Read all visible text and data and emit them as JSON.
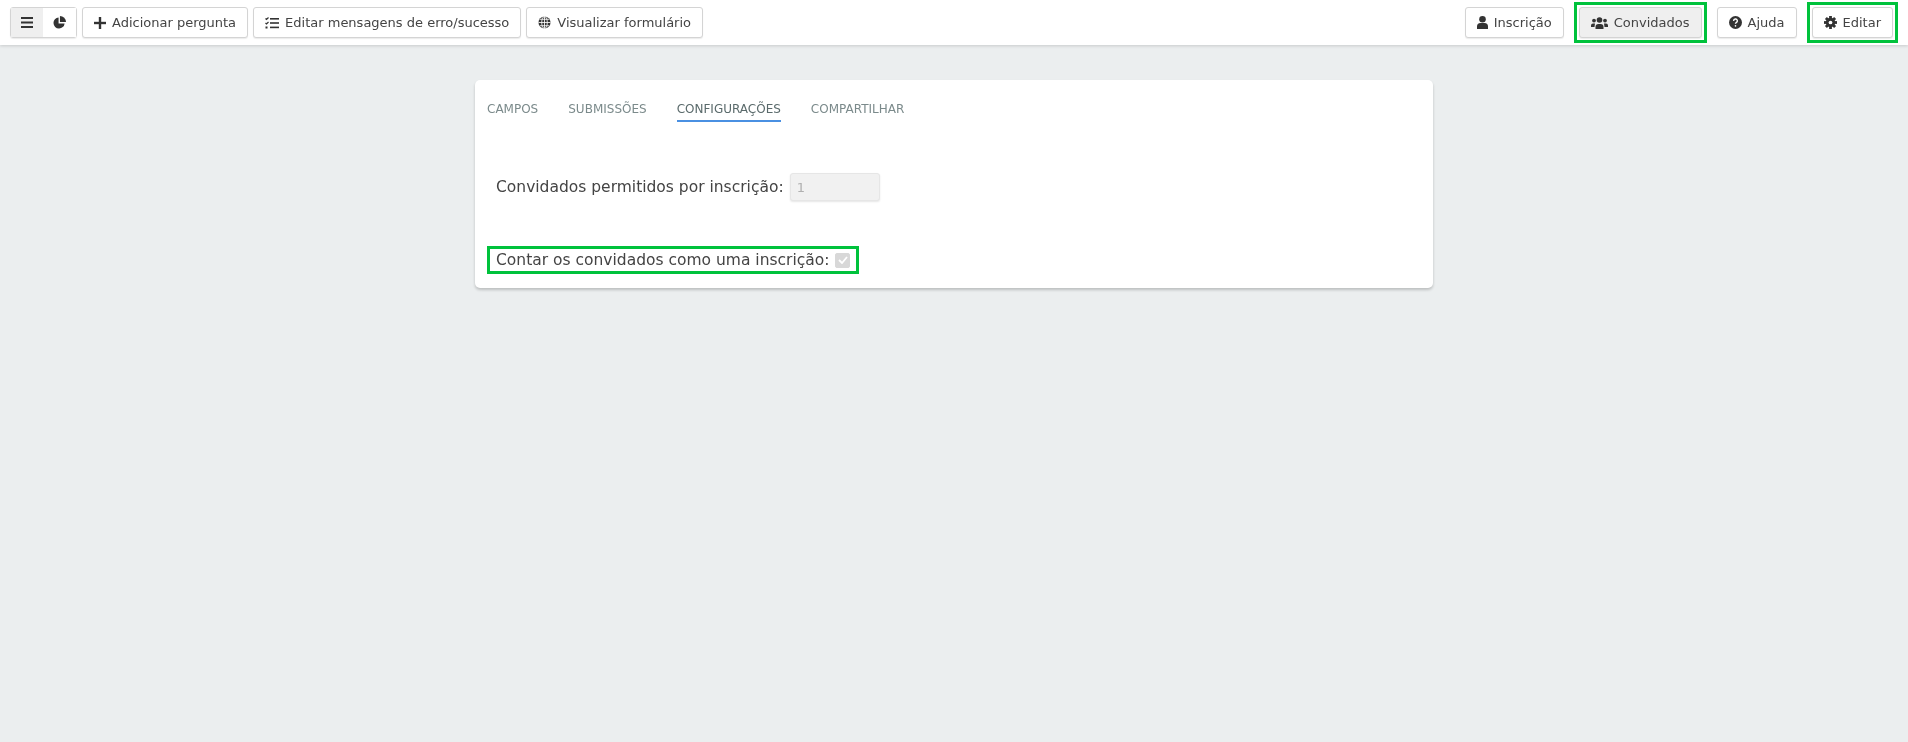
{
  "toolbar": {
    "view_toggle": [
      {
        "kind": "list",
        "selected": true
      },
      {
        "kind": "pie",
        "selected": false
      }
    ],
    "left_buttons": [
      {
        "kind": "add",
        "label": "Adicionar pergunta"
      },
      {
        "kind": "messages",
        "label": "Editar mensagens de erro/sucesso"
      },
      {
        "kind": "preview",
        "label": "Visualizar formulário"
      }
    ],
    "right_buttons": [
      {
        "kind": "user",
        "label": "Inscrição",
        "selected": false,
        "highlighted": false
      },
      {
        "kind": "users",
        "label": "Convidados",
        "selected": true,
        "highlighted": true
      },
      {
        "kind": "help",
        "label": "Ajuda",
        "selected": false,
        "highlighted": false
      },
      {
        "kind": "settings",
        "label": "Editar",
        "selected": false,
        "highlighted": true
      }
    ]
  },
  "tabs": [
    {
      "label": "CAMPOS",
      "selected": false
    },
    {
      "label": "SUBMISSÕES",
      "selected": false
    },
    {
      "label": "CONFIGURAÇÕES",
      "selected": true
    },
    {
      "label": "COMPARTILHAR",
      "selected": false
    }
  ],
  "settings": [
    {
      "kind": "number",
      "label": "Convidados permitidos por inscrição:",
      "placeholder": "1",
      "highlighted": false,
      "disabled": true
    },
    {
      "kind": "checkbox",
      "label": "Contar os convidados como uma inscrição:",
      "checked": true,
      "highlighted": true,
      "disabled": true
    }
  ]
}
